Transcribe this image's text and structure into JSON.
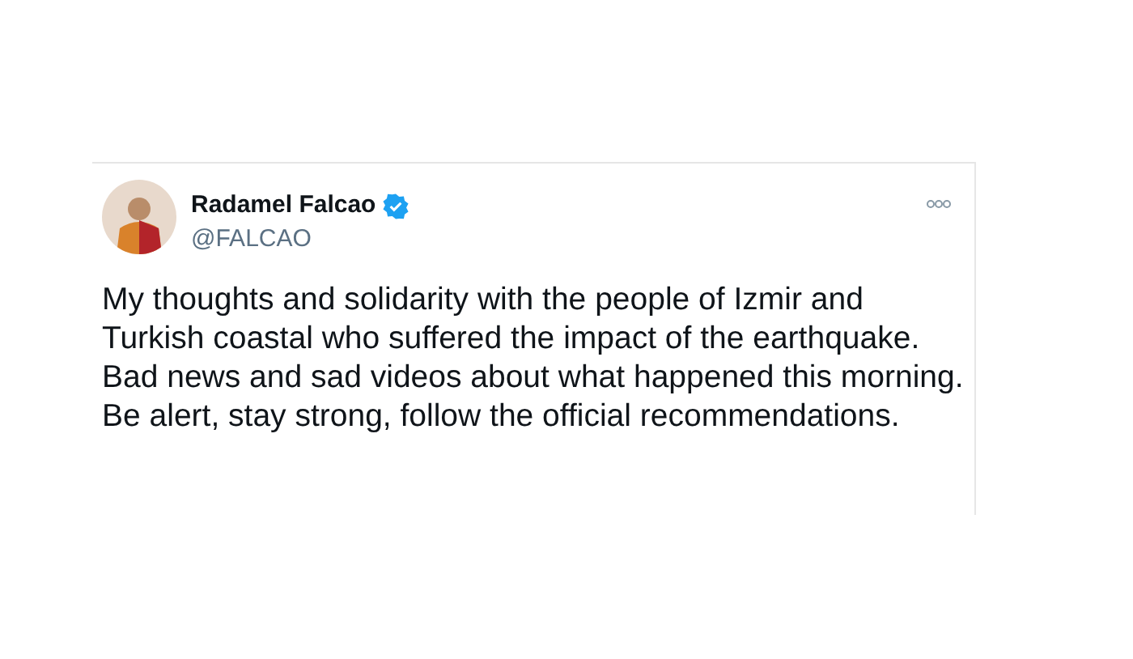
{
  "tweet": {
    "author_name": "Radamel Falcao",
    "verified": true,
    "handle": "@FALCAO",
    "text": "My thoughts and solidarity with the people of Izmir and Turkish coastal who suffered the impact of the earthquake.  Bad news and sad videos about what happened this morning.  Be alert, stay strong, follow the official recommendations."
  }
}
